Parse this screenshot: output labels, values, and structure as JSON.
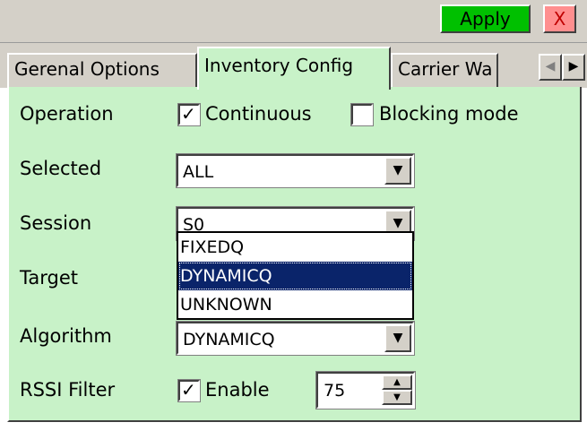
{
  "toolbar": {
    "apply_label": "Apply",
    "close_label": "X"
  },
  "tabs": [
    {
      "label": "Gerenal Options"
    },
    {
      "label": "Inventory Config"
    },
    {
      "label": "Carrier Wa"
    }
  ],
  "tab_scroll": {
    "left": "◀",
    "right": "▶"
  },
  "form": {
    "operation": {
      "label": "Operation",
      "continuous": {
        "label": "Continuous",
        "checked": true
      },
      "blocking": {
        "label": "Blocking mode",
        "checked": false
      }
    },
    "selected": {
      "label": "Selected",
      "value": "ALL"
    },
    "session": {
      "label": "Session",
      "value": "S0"
    },
    "target": {
      "label": "Target"
    },
    "algorithm": {
      "label": "Algorithm",
      "value": "DYNAMICQ",
      "options": [
        "FIXEDQ",
        "DYNAMICQ",
        "UNKNOWN"
      ],
      "highlighted": "DYNAMICQ"
    },
    "rssi": {
      "label": "RSSI Filter",
      "enable_label": "Enable",
      "enabled": true,
      "value": "75"
    }
  },
  "glyphs": {
    "check": "✓",
    "down": "▼",
    "up": "▲"
  },
  "colors": {
    "panel": "#c8f2c8",
    "apply": "#00c000",
    "close": "#ff8f8f",
    "selection": "#0a246a"
  }
}
